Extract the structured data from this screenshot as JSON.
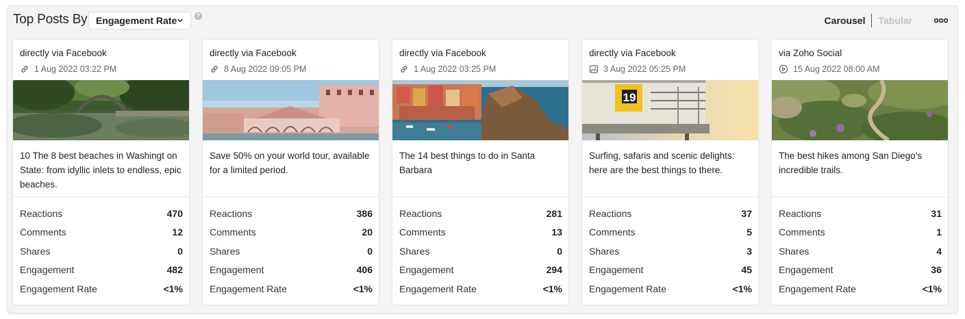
{
  "header": {
    "title": "Top Posts By",
    "dropdown_value": "Engagement Rate",
    "help_symbol": "?",
    "view_carousel": "Carousel",
    "view_tabular": "Tabular"
  },
  "stat_labels": {
    "reactions": "Reactions",
    "comments": "Comments",
    "shares": "Shares",
    "engagement": "Engagement",
    "engagement_rate": "Engagement Rate"
  },
  "posts": [
    {
      "source": "directly via Facebook",
      "date": "1 Aug 2022 03:22 PM",
      "type_icon": "link-icon",
      "caption": "10 The 8 best beaches in Washingt on State: from idyllic inlets to endless, epic beaches.",
      "reactions": "470",
      "comments": "12",
      "shares": "0",
      "engagement": "482",
      "engagement_rate": "<1%"
    },
    {
      "source": "directly via Facebook",
      "date": "8 Aug 2022 09:05 PM",
      "type_icon": "link-icon",
      "caption": "Save 50% on your world tour, available for a limited period.",
      "reactions": "386",
      "comments": "20",
      "shares": "0",
      "engagement": "406",
      "engagement_rate": "<1%"
    },
    {
      "source": "directly via Facebook",
      "date": "1 Aug 2022 03:25 PM",
      "type_icon": "link-icon",
      "caption": "The 14 best things to do in Santa Barbara",
      "reactions": "281",
      "comments": "13",
      "shares": "0",
      "engagement": "294",
      "engagement_rate": "<1%"
    },
    {
      "source": "directly via Facebook",
      "date": "3 Aug 2022 05:25 PM",
      "type_icon": "image-icon",
      "image_text": "19",
      "caption": "Surfing, safaris and scenic delights: here are the best things to there.",
      "reactions": "37",
      "comments": "5",
      "shares": "3",
      "engagement": "45",
      "engagement_rate": "<1%"
    },
    {
      "source": "via Zoho Social",
      "date": "15 Aug 2022 08:00 AM",
      "type_icon": "video-icon",
      "caption": "The best hikes among San Diego’s incredible trails.",
      "reactions": "31",
      "comments": "1",
      "shares": "4",
      "engagement": "36",
      "engagement_rate": "<1%"
    }
  ]
}
